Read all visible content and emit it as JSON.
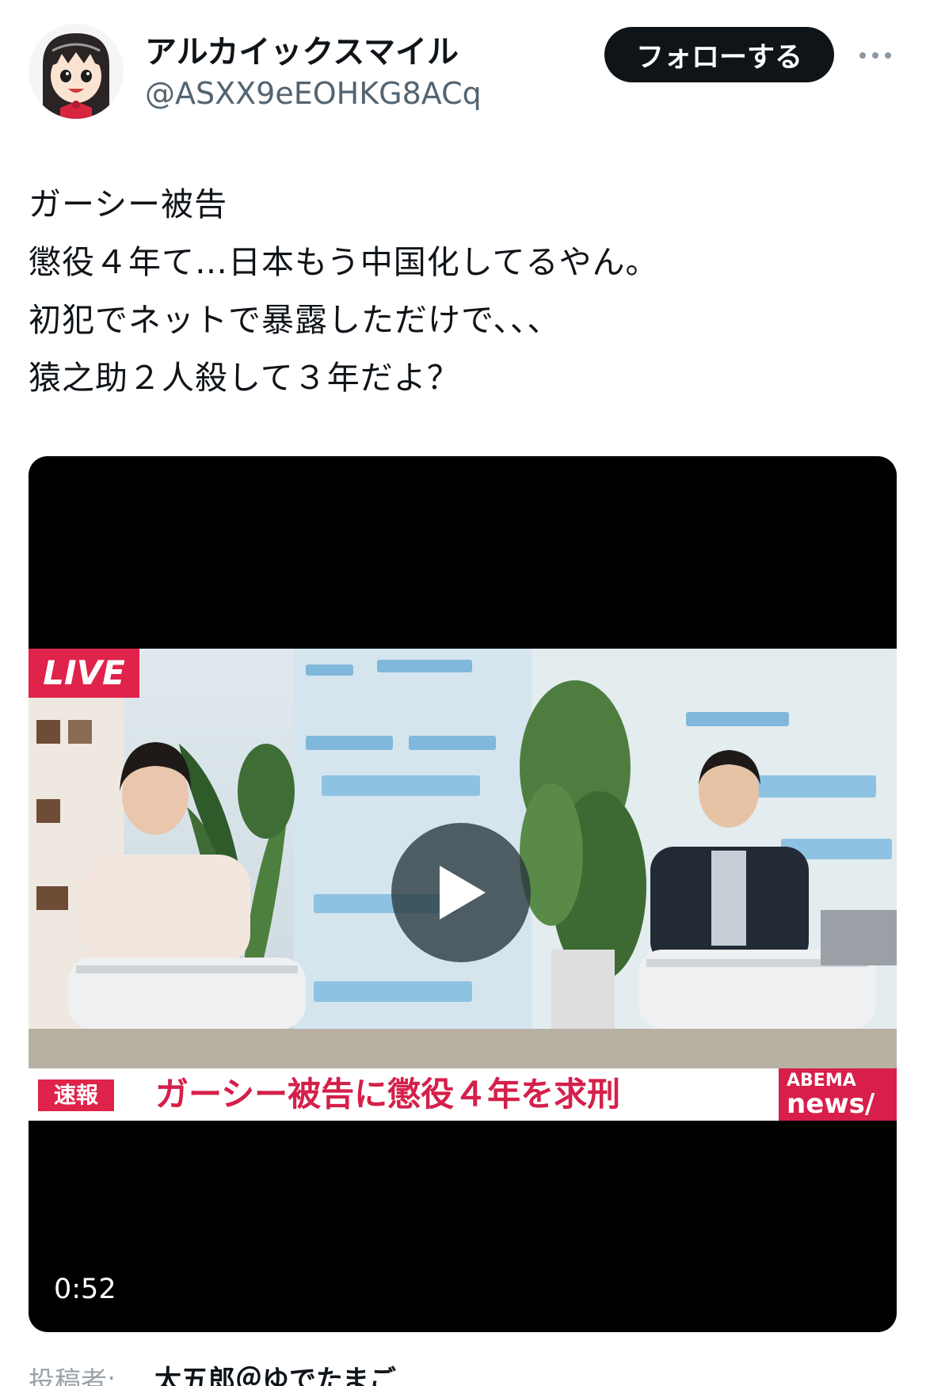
{
  "user": {
    "display_name": "アルカイックスマイル",
    "handle": "@ASXX9eEOHKG8ACq",
    "avatar_icon": "anime-girl-avatar"
  },
  "header": {
    "follow_label": "フォローする",
    "more_icon": "more-dots-icon"
  },
  "tweet": {
    "lines": [
      "ガーシー被告",
      "懲役４年て…日本もう中国化してるやん。",
      "初犯でネットで暴露しただけで、、、",
      "猿之助２人殺して３年だよ？"
    ]
  },
  "video": {
    "duration": "0:52",
    "play_icon": "play-icon",
    "live_label": "LIVE",
    "breaking_label": "速報",
    "headline": "ガーシー被告に懲役４年を求刑",
    "logo_top": "ABEMA",
    "logo_bottom": "news/",
    "colors": {
      "accent": "#e0234a",
      "headline": "#d4204a",
      "background": "#000000"
    }
  },
  "footer": {
    "posted_by_label": "投稿者:",
    "poster_name": "太五郎＠ゆでたまご"
  },
  "colors": {
    "text": "#0f1419",
    "secondary": "#536471",
    "button": "#0f1419"
  }
}
